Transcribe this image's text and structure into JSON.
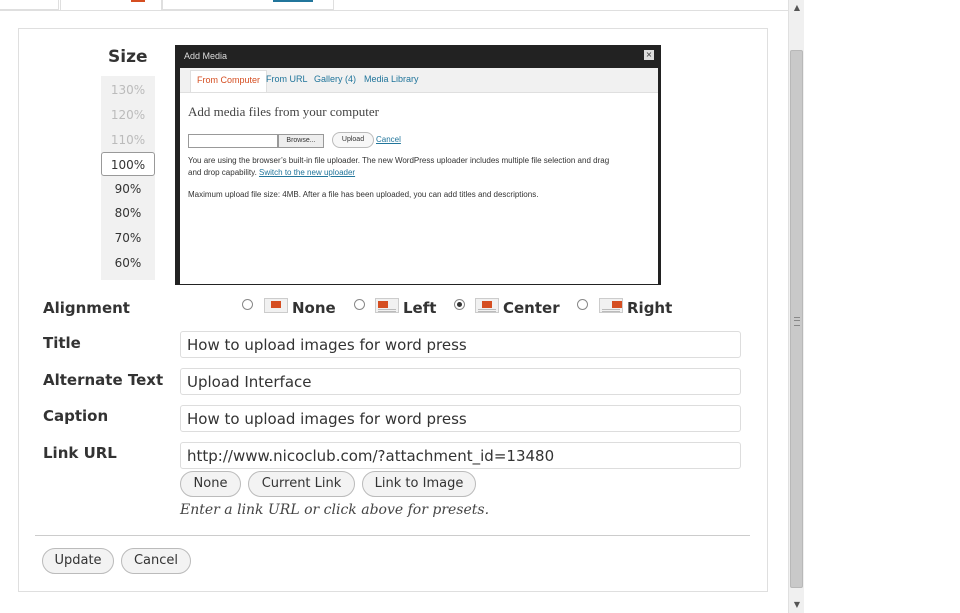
{
  "size": {
    "label": "Size",
    "options": [
      "130%",
      "120%",
      "110%",
      "100%",
      "90%",
      "80%",
      "70%",
      "60%"
    ],
    "selected": "100%"
  },
  "preview": {
    "window_title": "Add Media",
    "close_glyph": "×",
    "tabs": [
      "From Computer",
      "From URL",
      "Gallery (4)",
      "Media Library"
    ],
    "active_tab": "From Computer",
    "heading": "Add media files from your computer",
    "browse_label": "Browse...",
    "upload_label": "Upload",
    "cancel_label": "Cancel",
    "para1_text": "You are using the browser’s built-in file uploader. The new WordPress uploader includes multiple file selection and drag",
    "para1_line2": "and drop capability.",
    "para1_link": "Switch to the new uploader",
    "para2_text": "Maximum upload file size: 4MB. After a file has been uploaded, you can add titles and descriptions."
  },
  "alignment": {
    "label": "Alignment",
    "options": [
      "None",
      "Left",
      "Center",
      "Right"
    ],
    "selected": "Center"
  },
  "title": {
    "label": "Title",
    "value": "How to upload images for word press"
  },
  "alt_text": {
    "label": "Alternate Text",
    "value": "Upload Interface"
  },
  "caption": {
    "label": "Caption",
    "value": "How to upload images for word press"
  },
  "link_url": {
    "label": "Link URL",
    "value": "http://www.nicoclub.com/?attachment_id=13480",
    "presets": [
      "None",
      "Current Link",
      "Link to Image"
    ],
    "hint": "Enter a link URL or click above for presets."
  },
  "actions": {
    "update_label": "Update",
    "cancel_label": "Cancel"
  },
  "colors": {
    "accent": "#d54e21",
    "link": "#21759b"
  }
}
